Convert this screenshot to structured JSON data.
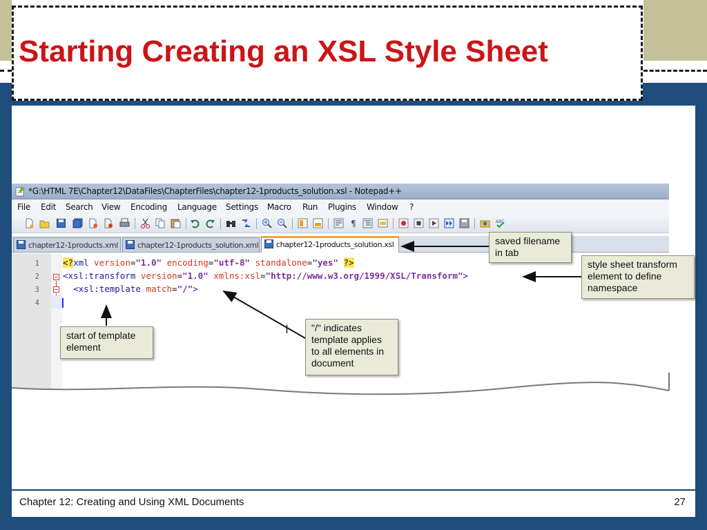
{
  "slide": {
    "title": "Starting Creating an XSL Style Sheet",
    "footer_text": "Chapter 12: Creating and Using XML Documents",
    "page_number": "27",
    "colors": {
      "title": "#cc1417",
      "background_blue": "#1f4e7c",
      "band_tan": "#c4c09a",
      "callout_fill": "#e9ebd8"
    }
  },
  "screenshot": {
    "window_title": "*G:\\HTML 7E\\Chapter12\\DataFiles\\ChapterFiles\\chapter12-1products_solution.xsl - Notepad++",
    "menu": [
      "File",
      "Edit",
      "Search",
      "View",
      "Encoding",
      "Language",
      "Settings",
      "Macro",
      "Run",
      "Plugins",
      "Window",
      "?"
    ],
    "toolbar_icons": [
      "new-file-icon",
      "open-file-icon",
      "save-icon",
      "save-all-icon",
      "close-icon",
      "close-all-icon",
      "print-icon",
      "cut-icon",
      "copy-icon",
      "paste-icon",
      "undo-icon",
      "redo-icon",
      "find-icon",
      "replace-icon",
      "zoom-in-icon",
      "zoom-out-icon",
      "sync-vertical-icon",
      "sync-horizontal-icon",
      "word-wrap-icon",
      "show-all-chars-icon",
      "indent-guide-icon",
      "user-lang-icon",
      "record-macro-icon",
      "stop-macro-icon",
      "play-macro-icon",
      "run-macro-multiple-icon",
      "save-macro-icon",
      "launch-browser-icon",
      "spell-check-icon"
    ],
    "tabs": [
      "chapter12-1products.xml",
      "chapter12-1products_solution.xml",
      "chapter12-1products_solution.xsl"
    ],
    "active_tab": 2,
    "line_numbers": [
      "1",
      "2",
      "3",
      "4"
    ],
    "code": {
      "line1": {
        "pi_open": "<?",
        "name": "xml",
        "a1": "version",
        "v1": "\"1.0\"",
        "a2": "encoding",
        "v2": "\"utf-8\"",
        "a3": "standalone",
        "v3": "\"yes\"",
        "pi_close": "?>"
      },
      "line2": {
        "tag": "<xsl:transform",
        "a1": "version",
        "v1": "\"1.0\"",
        "a2": "xmlns:xsl",
        "v2": "\"http://www.w3.org/1999/XSL/Transform\"",
        "close": ">"
      },
      "line3": {
        "tag": "<xsl:template",
        "a1": "match",
        "v1": "\"/\"",
        "close": ">"
      }
    }
  },
  "callouts": {
    "saved_filename": "saved filename\nin tab",
    "transform_element": "style sheet transform\nelement to define\nnamespace",
    "template_start": "start of template\nelement",
    "root_template": "\"/\" indicates\ntemplate applies\nto all elements in\ndocument"
  }
}
